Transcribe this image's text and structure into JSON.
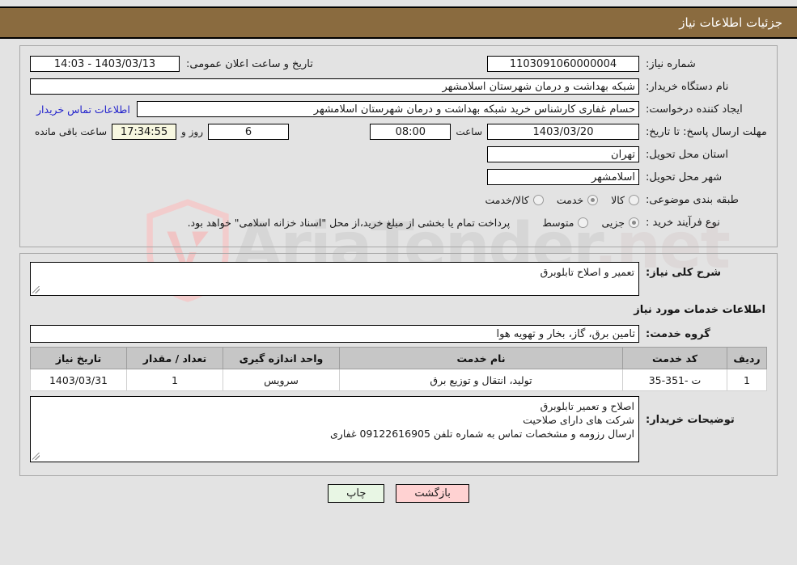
{
  "header": {
    "title": "جزئیات اطلاعات نیاز"
  },
  "colors": {
    "header_bg": "#8a6b3f",
    "page_bg": "#e3e3e3",
    "link": "#2222cc",
    "table_header_bg": "#c6c6c6",
    "back_button_bg": "#ffd2d2",
    "print_button_bg": "#e8f6e4",
    "timer_bg": "#f7f7e0"
  },
  "watermark": {
    "text": "AriaTender",
    "tld": ".net"
  },
  "form": {
    "need_number_label": "شماره نیاز:",
    "need_number_value": "1103091060000004",
    "announce_datetime_label": "تاریخ و ساعت اعلان عمومی:",
    "announce_datetime_value": "1403/03/13 - 14:03",
    "buyer_org_label": "نام دستگاه خریدار:",
    "buyer_org_value": "شبکه بهداشت و درمان شهرستان اسلامشهر",
    "requester_label": "ایجاد کننده درخواست:",
    "requester_value": "حسام غفاری کارشناس خرید شبکه بهداشت و درمان شهرستان اسلامشهر",
    "contact_link": "اطلاعات تماس خریدار",
    "deadline_label": "مهلت ارسال پاسخ: تا تاریخ:",
    "deadline_date": "1403/03/20",
    "time_label": "ساعت",
    "deadline_time": "08:00",
    "days_value": "6",
    "days_label": "روز و",
    "countdown_value": "17:34:55",
    "remaining_label": "ساعت باقی مانده",
    "province_label": "استان محل تحویل:",
    "province_value": "تهران",
    "city_label": "شهر محل تحویل:",
    "city_value": "اسلامشهر",
    "category_label": "طبقه بندی موضوعی:",
    "category_options": [
      {
        "label": "کالا",
        "selected": false
      },
      {
        "label": "خدمت",
        "selected": true
      },
      {
        "label": "کالا/خدمت",
        "selected": false
      }
    ],
    "purchase_type_label": "نوع فرآیند خرید :",
    "purchase_type_options": [
      {
        "label": "جزیی",
        "selected": true
      },
      {
        "label": "متوسط",
        "selected": false
      }
    ],
    "payment_note": "پرداخت تمام یا بخشی از مبلغ خرید،از محل \"اسناد خزانه اسلامی\" خواهد بود."
  },
  "details": {
    "general_desc_label": "شرح کلی نیاز:",
    "general_desc_value": "تعمیر و اصلاح تابلوبرق",
    "services_section_title": "اطلاعات خدمات مورد نیاز",
    "service_group_label": "گروه خدمت:",
    "service_group_value": "تامین برق، گاز، بخار و تهویه هوا"
  },
  "table": {
    "columns": [
      "ردیف",
      "کد خدمت",
      "نام خدمت",
      "واحد اندازه گیری",
      "تعداد / مقدار",
      "تاریخ نیاز"
    ],
    "rows": [
      {
        "row_no": "1",
        "service_code": "ت -351-35",
        "service_name": "تولید، انتقال و توزیع برق",
        "unit": "سرویس",
        "quantity": "1",
        "need_date": "1403/03/31"
      }
    ]
  },
  "buyer_notes": {
    "label": "توضیحات خریدار:",
    "value": "اصلاح و تعمیر تابلوبرق\nشرکت های دارای صلاحیت\nارسال رزومه و مشخصات تماس به  شماره تلفن 09122616905 غفاری"
  },
  "footer": {
    "back_label": "بازگشت",
    "print_label": "چاپ"
  }
}
